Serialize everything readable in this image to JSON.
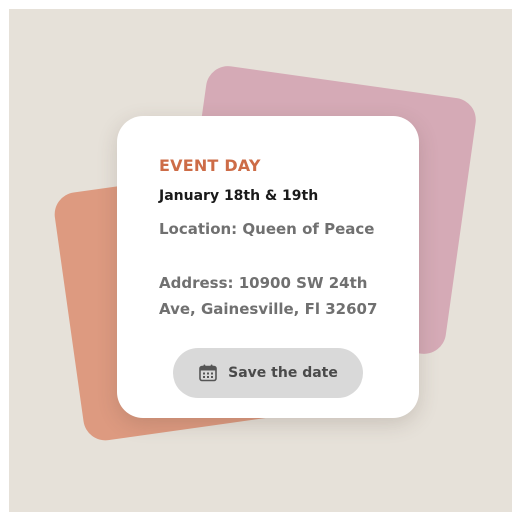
{
  "card": {
    "eyebrow": "EVENT DAY",
    "dates": "January 18th & 19th",
    "location": "Location: Queen of Peace",
    "address_line1": "Address: 10900 SW 24th",
    "address_line2": "Ave, Gainesville, Fl 32607",
    "button_label": "Save the date",
    "button_icon": "calendar-icon"
  },
  "colors": {
    "background": "#e6e1d9",
    "accent": "#cd6c47",
    "back_card_pink": "#d5aab6",
    "back_card_orange": "#dd9a80",
    "button_bg": "#d9d9d9"
  }
}
